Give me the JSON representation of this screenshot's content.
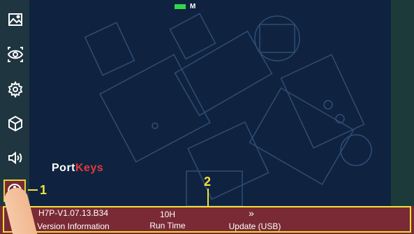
{
  "status": {
    "indicator_text": "M"
  },
  "logo": {
    "part1": "Port",
    "part2": "Keys"
  },
  "bottom_bar": {
    "firmware": "H7P-V1.07.13.B34",
    "firmware_label": "Version Information",
    "runtime_value": "10H",
    "runtime_label": "Run Time",
    "update_arrow": "»",
    "update_label": "Update (USB)"
  },
  "callouts": {
    "one": "1",
    "two": "2"
  },
  "sidebar": {
    "items": [
      {
        "name": "image"
      },
      {
        "name": "eye"
      },
      {
        "name": "settings"
      },
      {
        "name": "cube"
      },
      {
        "name": "speaker"
      },
      {
        "name": "info"
      }
    ]
  },
  "colors": {
    "sidebar_bg": "#1f3540",
    "main_bg": "#0f2340",
    "bar_bg": "#7a2a34",
    "highlight": "#f2e23a",
    "battery": "#33d64a"
  }
}
